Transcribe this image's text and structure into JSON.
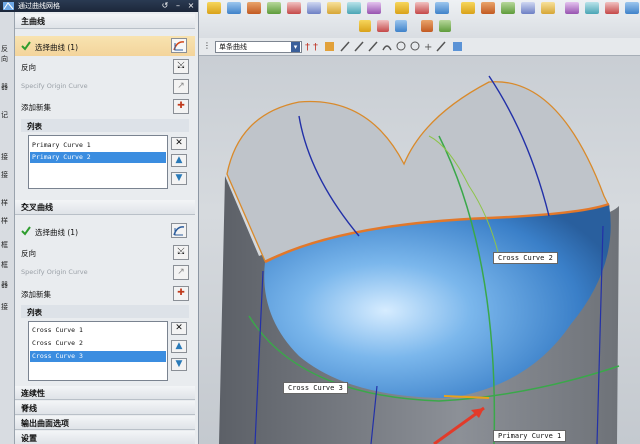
{
  "dialog": {
    "title": "通过曲线网格",
    "primary_section": {
      "header": "主曲线",
      "select_curve": "选择曲线 (1)",
      "reverse": "反向",
      "specify_origin": "Specify Origin Curve",
      "add_new_set": "添加新集",
      "list_header": "列表",
      "items": [
        "Primary Curve  1",
        "Primary Curve  2"
      ],
      "selected_index": 1
    },
    "cross_section": {
      "header": "交叉曲线",
      "select_curve": "选择曲线 (1)",
      "reverse": "反向",
      "specify_origin": "Specify Origin Curve",
      "add_new_set": "添加新集",
      "list_header": "列表",
      "items": [
        "Cross Curve  1",
        "Cross Curve  2",
        "Cross Curve  3"
      ],
      "selected_index": 2
    },
    "collapsed_sections": [
      "连续性",
      "脊线",
      "输出曲面选项",
      "设置"
    ]
  },
  "left_strip": [
    "反向",
    "器",
    "记",
    "接",
    "接",
    "样",
    "样",
    "框",
    "框",
    "器",
    "接"
  ],
  "toolbar": {
    "curve_rule": "单条曲线"
  },
  "viewport": {
    "labels": {
      "cross_2": "Cross Curve  2",
      "cross_3": "Cross Curve  3",
      "primary_1": "Primary Curve  1"
    }
  }
}
